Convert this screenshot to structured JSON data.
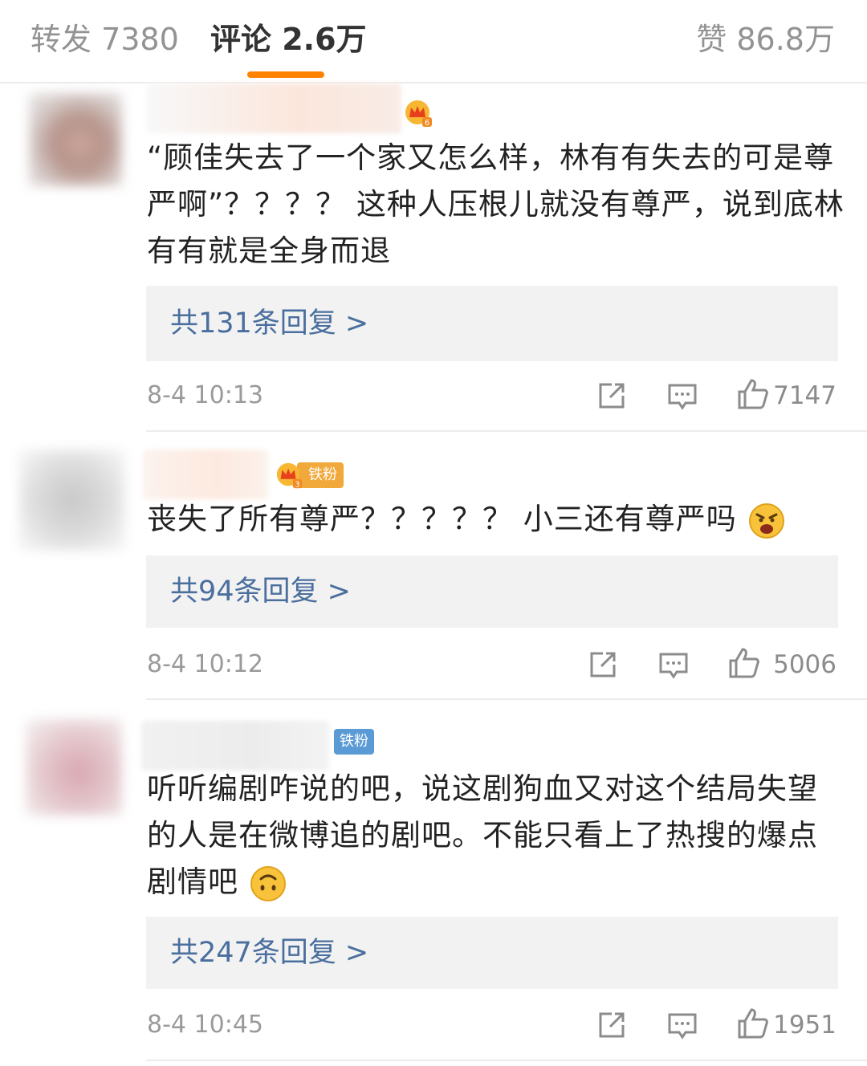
{
  "tabs": {
    "reposts": "转发 7380",
    "comments": "评论 2.6万",
    "likes": "赞 86.8万"
  },
  "colors": {
    "accent": "#ff8200",
    "link": "#4a6e9e",
    "reply_bg": "#f2f2f2",
    "fan_badge": "#5b9bd5"
  },
  "comments": [
    {
      "badges": [
        "crown-icon"
      ],
      "text": "“顾佳失去了一个家又怎么样，林有有失去的可是尊严啊”？？？？ 这种人压根儿就没有尊严，说到底林有有就是全身而退",
      "replies": "共131条回复 >",
      "time": "8-4 10:13",
      "likes": "7147"
    },
    {
      "badges": [
        "crown-icon",
        "iron-fan-badge"
      ],
      "fan_label": "铁粉",
      "text": "丧失了所有尊严？？？？？ 小三还有尊严吗",
      "emoji": "angry-face-icon",
      "replies": "共94条回复 >",
      "time": "8-4 10:12",
      "likes": "5006"
    },
    {
      "badges": [
        "iron-fan-badge"
      ],
      "fan_label": "铁粉",
      "text": "听听编剧咋说的吧，说这剧狗血又对这个结局失望的人是在微博追的剧吧。不能只看上了热搜的爆点剧情吧",
      "emoji": "upside-down-face-icon",
      "replies": "共247条回复 >",
      "time": "8-4 10:45",
      "likes": "1951"
    }
  ]
}
